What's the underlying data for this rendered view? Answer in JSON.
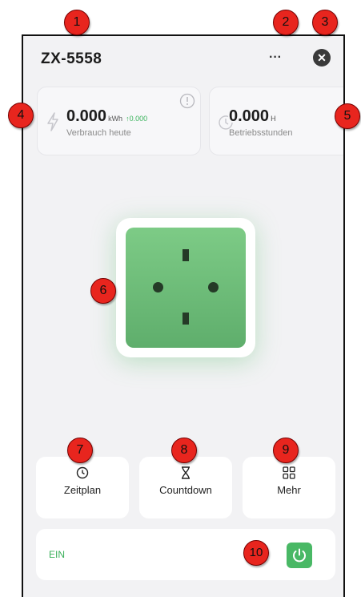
{
  "device": {
    "name": "ZX-5558"
  },
  "header": {
    "more_glyph": "···",
    "close_glyph": "✕"
  },
  "energy": {
    "value": "0.000",
    "unit": "kWh",
    "delta": "0.000",
    "label": "Verbrauch heute"
  },
  "hours": {
    "value": "0.000",
    "unit": "H",
    "label": "Betriebsstunden"
  },
  "actions": [
    {
      "label": "Zeitplan",
      "icon": "clock-icon"
    },
    {
      "label": "Countdown",
      "icon": "hourglass-icon"
    },
    {
      "label": "Mehr",
      "icon": "grid-icon"
    }
  ],
  "power": {
    "label": "EIN",
    "state": "on"
  },
  "callouts": [
    "1",
    "2",
    "3",
    "4",
    "5",
    "6",
    "7",
    "8",
    "9",
    "10"
  ],
  "colors": {
    "accent_green": "#49b865",
    "callout_red": "#e8251e",
    "background": "#f2f2f4"
  }
}
